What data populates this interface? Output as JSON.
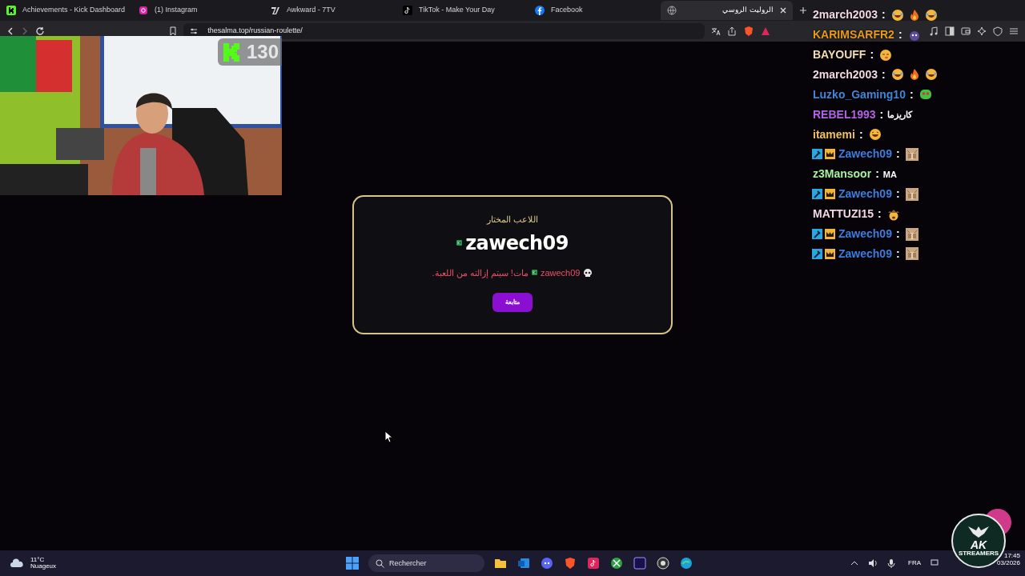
{
  "browser": {
    "tabs": [
      {
        "title": "Achievements - Kick Dashboard",
        "selected": false
      },
      {
        "title": "(1) Instagram",
        "selected": false
      },
      {
        "title": "Awkward - 7TV",
        "selected": false
      },
      {
        "title": "TikTok - Make Your Day",
        "selected": false
      },
      {
        "title": "Facebook",
        "selected": false
      },
      {
        "title": "الروليت الروسي",
        "selected": true
      }
    ],
    "url": "thesalma.top/russian-roulette/"
  },
  "stream_overlay": {
    "viewer_count": "130",
    "chat_separator": ":",
    "chat": [
      {
        "name": "2march2003",
        "color": "#f3d7e0",
        "kind": "viewer"
      },
      {
        "name": "KARIMSARFR2",
        "color": "#e89a1c",
        "kind": "viewer"
      },
      {
        "name": "BAYOUFF",
        "color": "#f3ddb0",
        "kind": "viewer"
      },
      {
        "name": "2march2003",
        "color": "#f3d7e0",
        "kind": "viewer"
      },
      {
        "name": "Luzko_Gaming10",
        "color": "#3f86d8",
        "kind": "viewer"
      },
      {
        "name": "REBEL1993",
        "color": "#b463e6",
        "kind": "viewer",
        "message": "كاريزما"
      },
      {
        "name": "itamemi",
        "color": "#f0c45c",
        "kind": "viewer"
      },
      {
        "name": "Zawech09",
        "color": "#3a7ee0",
        "kind": "moderator"
      },
      {
        "name": "z3Mansoor",
        "color": "#a9f0a0",
        "kind": "viewer",
        "message": "MA"
      },
      {
        "name": "Zawech09",
        "color": "#3a7ee0",
        "kind": "moderator"
      },
      {
        "name": "MATTUZI15",
        "color": "#f3d7e0",
        "kind": "viewer"
      },
      {
        "name": "Zawech09",
        "color": "#3a7ee0",
        "kind": "moderator"
      },
      {
        "name": "Zawech09",
        "color": "#3a7ee0",
        "kind": "moderator"
      }
    ]
  },
  "modal": {
    "heading": "اللاعب المختار",
    "player": "zawech09",
    "message_name": "zawech09",
    "message": "مات! سيتم إزالته من اللعبة.",
    "button": "متابعة"
  },
  "taskbar": {
    "temperature": "11°C",
    "weather": "Nuageux",
    "search_placeholder": "Rechercher",
    "language": "FRA",
    "time": "17:45",
    "date": "03/2026"
  },
  "logo": {
    "text": "AK",
    "subtext": "STREAMERS"
  }
}
